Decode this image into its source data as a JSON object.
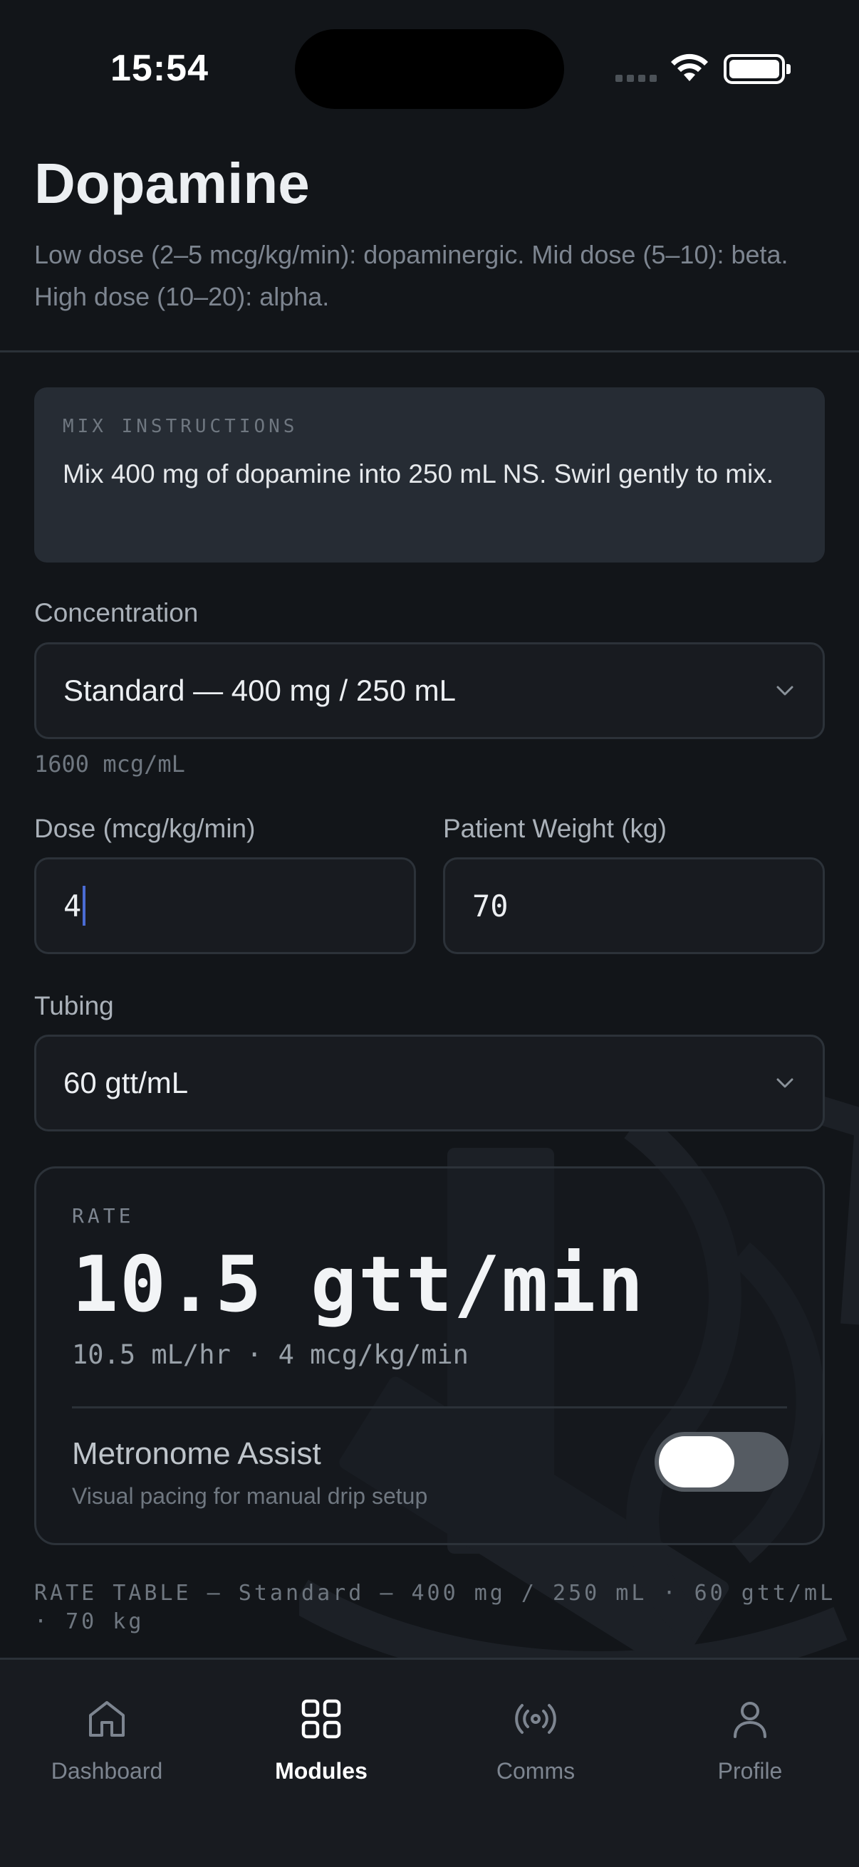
{
  "status_bar": {
    "time": "15:54"
  },
  "header": {
    "title": "Dopamine",
    "subtitle": "Low dose (2–5 mcg/kg/min): dopaminergic. Mid dose (5–10): beta. High dose (10–20): alpha."
  },
  "mix": {
    "label": "MIX INSTRUCTIONS",
    "text": "Mix 400 mg of dopamine into 250 mL NS. Swirl gently to mix."
  },
  "concentration": {
    "label": "Concentration",
    "value": "Standard — 400 mg / 250 mL",
    "hint": "1600 mcg/mL"
  },
  "dose": {
    "label": "Dose (mcg/kg/min)",
    "value": "4"
  },
  "weight": {
    "label": "Patient Weight (kg)",
    "value": "70"
  },
  "tubing": {
    "label": "Tubing",
    "value": "60 gtt/mL"
  },
  "rate": {
    "label": "RATE",
    "value": "10.5 gtt/min",
    "sub": "10.5 mL/hr · 4 mcg/kg/min",
    "metronome_title": "Metronome Assist",
    "metronome_sub": "Visual pacing for manual drip setup",
    "metronome_on": true
  },
  "rate_table": {
    "label": "RATE TABLE — Standard — 400 mg / 250 mL · 60 gtt/mL · 70 kg"
  },
  "nav": {
    "items": [
      {
        "label": "Dashboard",
        "icon": "home-icon",
        "active": false
      },
      {
        "label": "Modules",
        "icon": "grid-icon",
        "active": true
      },
      {
        "label": "Comms",
        "icon": "broadcast-icon",
        "active": false
      },
      {
        "label": "Profile",
        "icon": "person-icon",
        "active": false
      }
    ]
  },
  "colors": {
    "background": "#121519",
    "card": "#262c34",
    "accent_caret": "#4a6cd4"
  }
}
